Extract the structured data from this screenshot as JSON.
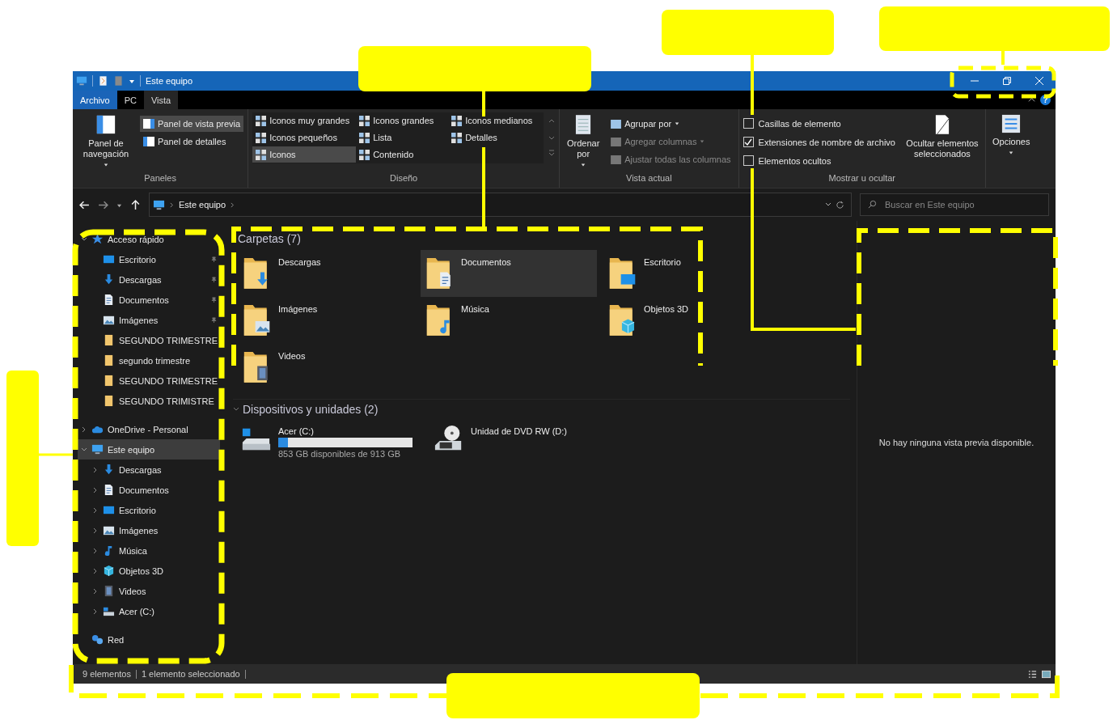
{
  "window": {
    "title": "Este equipo"
  },
  "ribbon_tabs": [
    {
      "label": "Archivo",
      "kind": "file",
      "selected": false
    },
    {
      "label": "PC",
      "kind": "tab",
      "selected": false
    },
    {
      "label": "Vista",
      "kind": "tab",
      "selected": true
    }
  ],
  "ribbon_help": "?",
  "ribbon": {
    "panes": {
      "label": "Paneles",
      "navigation_pane": "Panel de navegación",
      "items": [
        {
          "label": "Panel de vista previa",
          "selected": true
        },
        {
          "label": "Panel de detalles",
          "selected": false
        }
      ]
    },
    "layout": {
      "label": "Diseño",
      "options": [
        {
          "label": "Iconos muy grandes",
          "selected": false
        },
        {
          "label": "Iconos grandes",
          "selected": false
        },
        {
          "label": "Iconos medianos",
          "selected": false
        },
        {
          "label": "Iconos pequeños",
          "selected": false
        },
        {
          "label": "Lista",
          "selected": false
        },
        {
          "label": "Detalles",
          "selected": false
        },
        {
          "label": "Iconos",
          "selected": true
        },
        {
          "label": "Contenido",
          "selected": false
        }
      ]
    },
    "current_view": {
      "label": "Vista actual",
      "sort": "Ordenar por",
      "items": [
        {
          "label": "Agrupar por",
          "disabled": false,
          "dropdown": true
        },
        {
          "label": "Agregar columnas",
          "disabled": true,
          "dropdown": true
        },
        {
          "label": "Ajustar todas las columnas",
          "disabled": true,
          "dropdown": false
        }
      ]
    },
    "show_hide": {
      "label": "Mostrar u ocultar",
      "checkboxes": [
        {
          "label": "Casillas de elemento",
          "checked": false
        },
        {
          "label": "Extensiones de nombre de archivo",
          "checked": true
        },
        {
          "label": "Elementos ocultos",
          "checked": false
        }
      ],
      "hide_selected": "Ocultar elementos seleccionados"
    },
    "options": {
      "label": "Opciones"
    }
  },
  "address_bar": {
    "path": [
      "Este equipo"
    ],
    "search_placeholder": "Buscar en Este equipo"
  },
  "navigation": {
    "items": [
      {
        "label": "Acceso rápido",
        "kind": "star",
        "expanded": true,
        "selected": false,
        "children": [
          {
            "label": "Escritorio",
            "kind": "desktop",
            "pinned": true
          },
          {
            "label": "Descargas",
            "kind": "downloads",
            "pinned": true
          },
          {
            "label": "Documentos",
            "kind": "documents",
            "pinned": true
          },
          {
            "label": "Imágenes",
            "kind": "pictures",
            "pinned": true
          },
          {
            "label": "SEGUNDO TRIMESTRE",
            "kind": "folder",
            "pinned": false
          },
          {
            "label": "segundo trimestre",
            "kind": "folder",
            "pinned": false
          },
          {
            "label": "SEGUNDO TRIMESTRE",
            "kind": "folder",
            "pinned": false
          },
          {
            "label": "SEGUNDO TRIMISTRE",
            "kind": "folder",
            "pinned": false
          }
        ]
      },
      {
        "label": "OneDrive - Personal",
        "kind": "cloud",
        "expanded": false,
        "selected": false
      },
      {
        "label": "Este equipo",
        "kind": "pc",
        "expanded": true,
        "selected": true,
        "children": [
          {
            "label": "Descargas",
            "kind": "downloads",
            "expanded": false
          },
          {
            "label": "Documentos",
            "kind": "documents",
            "expanded": false
          },
          {
            "label": "Escritorio",
            "kind": "desktop",
            "expanded": false
          },
          {
            "label": "Imágenes",
            "kind": "pictures",
            "expanded": false
          },
          {
            "label": "Música",
            "kind": "music",
            "expanded": false
          },
          {
            "label": "Objetos 3D",
            "kind": "objects3d",
            "expanded": false
          },
          {
            "label": "Videos",
            "kind": "videos",
            "expanded": false
          },
          {
            "label": "Acer (C:)",
            "kind": "drive",
            "expanded": false
          }
        ]
      },
      {
        "label": "Red",
        "kind": "network",
        "selected": false
      }
    ]
  },
  "content": {
    "folders_title": "Carpetas (7)",
    "folders": [
      {
        "name": "Descargas",
        "kind": "downloads",
        "selected": false
      },
      {
        "name": "Documentos",
        "kind": "documents",
        "selected": true
      },
      {
        "name": "Escritorio",
        "kind": "desktop",
        "selected": false
      },
      {
        "name": "Imágenes",
        "kind": "pictures",
        "selected": false
      },
      {
        "name": "Música",
        "kind": "music",
        "selected": false
      },
      {
        "name": "Objetos 3D",
        "kind": "objects3d",
        "selected": false
      },
      {
        "name": "Videos",
        "kind": "videos",
        "selected": false
      }
    ],
    "devices_title": "Dispositivos y unidades (2)",
    "devices": [
      {
        "name": "Acer (C:)",
        "kind": "system-drive",
        "level": 0.07,
        "free": "853 GB disponibles de 913 GB"
      },
      {
        "name": "Unidad de DVD RW (D:)",
        "kind": "dvd"
      }
    ]
  },
  "preview": {
    "message": "No hay ninguna vista previa disponible."
  },
  "status_bar": {
    "items": [
      "9 elementos",
      "1 elemento seleccionado"
    ]
  }
}
